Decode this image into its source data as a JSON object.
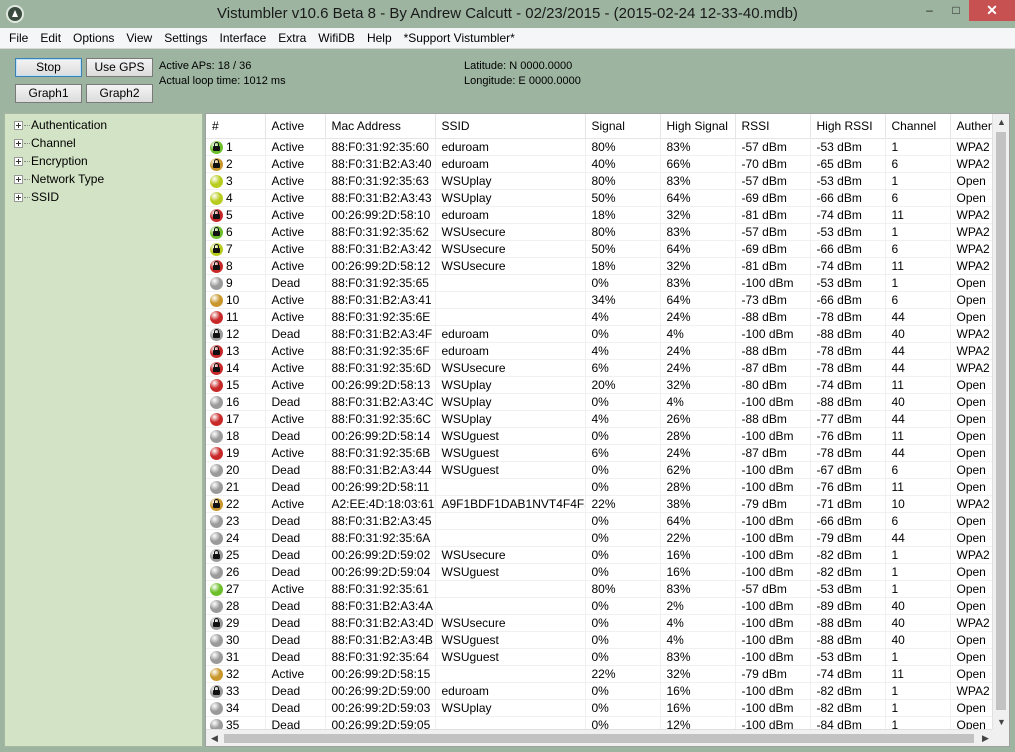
{
  "window": {
    "title": "Vistumbler v10.6 Beta 8 - By Andrew Calcutt - 02/23/2015 - (2015-02-24 12-33-40.mdb)",
    "minimize": "–",
    "maximize": "□",
    "close": "✕"
  },
  "menu": [
    "File",
    "Edit",
    "Options",
    "View",
    "Settings",
    "Interface",
    "Extra",
    "WifiDB",
    "Help",
    "*Support Vistumbler*"
  ],
  "controls": {
    "stop": "Stop",
    "use_gps": "Use GPS",
    "graph1": "Graph1",
    "graph2": "Graph2",
    "active_aps": "Active APs: 18 / 36",
    "loop_time": "Actual loop time: 1012 ms",
    "latitude": "Latitude: N 0000.0000",
    "longitude": "Longitude: E 0000.0000"
  },
  "tree": [
    "Authentication",
    "Channel",
    "Encryption",
    "Network Type",
    "SSID"
  ],
  "columns": [
    "#",
    "Active",
    "Mac Address",
    "SSID",
    "Signal",
    "High Signal",
    "RSSI",
    "High RSSI",
    "Channel",
    "Authen"
  ],
  "status_colors": {
    "green": "#6cbf2a",
    "yellowgreen": "#b8cc1e",
    "orange": "#c8962a",
    "red": "#c82828",
    "gray": "#9a9a9a"
  },
  "rows": [
    {
      "num": "1",
      "active": "Active",
      "mac": "88:F0:31:92:35:60",
      "ssid": "eduroam",
      "signal": "80%",
      "high_signal": "83%",
      "rssi": "-57 dBm",
      "high_rssi": "-53 dBm",
      "channel": "1",
      "auth": "WPA2",
      "color": "green",
      "lock": true
    },
    {
      "num": "2",
      "active": "Active",
      "mac": "88:F0:31:B2:A3:40",
      "ssid": "eduroam",
      "signal": "40%",
      "high_signal": "66%",
      "rssi": "-70 dBm",
      "high_rssi": "-65 dBm",
      "channel": "6",
      "auth": "WPA2",
      "color": "orange",
      "lock": true
    },
    {
      "num": "3",
      "active": "Active",
      "mac": "88:F0:31:92:35:63",
      "ssid": "WSUplay",
      "signal": "80%",
      "high_signal": "83%",
      "rssi": "-57 dBm",
      "high_rssi": "-53 dBm",
      "channel": "1",
      "auth": "Open",
      "color": "yellowgreen",
      "lock": false
    },
    {
      "num": "4",
      "active": "Active",
      "mac": "88:F0:31:B2:A3:43",
      "ssid": "WSUplay",
      "signal": "50%",
      "high_signal": "64%",
      "rssi": "-69 dBm",
      "high_rssi": "-66 dBm",
      "channel": "6",
      "auth": "Open",
      "color": "yellowgreen",
      "lock": false
    },
    {
      "num": "5",
      "active": "Active",
      "mac": "00:26:99:2D:58:10",
      "ssid": "eduroam",
      "signal": "18%",
      "high_signal": "32%",
      "rssi": "-81 dBm",
      "high_rssi": "-74 dBm",
      "channel": "11",
      "auth": "WPA2",
      "color": "red",
      "lock": true
    },
    {
      "num": "6",
      "active": "Active",
      "mac": "88:F0:31:92:35:62",
      "ssid": "WSUsecure",
      "signal": "80%",
      "high_signal": "83%",
      "rssi": "-57 dBm",
      "high_rssi": "-53 dBm",
      "channel": "1",
      "auth": "WPA2",
      "color": "green",
      "lock": true
    },
    {
      "num": "7",
      "active": "Active",
      "mac": "88:F0:31:B2:A3:42",
      "ssid": "WSUsecure",
      "signal": "50%",
      "high_signal": "64%",
      "rssi": "-69 dBm",
      "high_rssi": "-66 dBm",
      "channel": "6",
      "auth": "WPA2",
      "color": "yellowgreen",
      "lock": true
    },
    {
      "num": "8",
      "active": "Active",
      "mac": "00:26:99:2D:58:12",
      "ssid": "WSUsecure",
      "signal": "18%",
      "high_signal": "32%",
      "rssi": "-81 dBm",
      "high_rssi": "-74 dBm",
      "channel": "11",
      "auth": "WPA2",
      "color": "red",
      "lock": true
    },
    {
      "num": "9",
      "active": "Dead",
      "mac": "88:F0:31:92:35:65",
      "ssid": "",
      "signal": "0%",
      "high_signal": "83%",
      "rssi": "-100 dBm",
      "high_rssi": "-53 dBm",
      "channel": "1",
      "auth": "Open",
      "color": "gray",
      "lock": false
    },
    {
      "num": "10",
      "active": "Active",
      "mac": "88:F0:31:B2:A3:41",
      "ssid": "",
      "signal": "34%",
      "high_signal": "64%",
      "rssi": "-73 dBm",
      "high_rssi": "-66 dBm",
      "channel": "6",
      "auth": "Open",
      "color": "orange",
      "lock": false
    },
    {
      "num": "11",
      "active": "Active",
      "mac": "88:F0:31:92:35:6E",
      "ssid": "",
      "signal": "4%",
      "high_signal": "24%",
      "rssi": "-88 dBm",
      "high_rssi": "-78 dBm",
      "channel": "44",
      "auth": "Open",
      "color": "red",
      "lock": false
    },
    {
      "num": "12",
      "active": "Dead",
      "mac": "88:F0:31:B2:A3:4F",
      "ssid": "eduroam",
      "signal": "0%",
      "high_signal": "4%",
      "rssi": "-100 dBm",
      "high_rssi": "-88 dBm",
      "channel": "40",
      "auth": "WPA2",
      "color": "gray",
      "lock": true
    },
    {
      "num": "13",
      "active": "Active",
      "mac": "88:F0:31:92:35:6F",
      "ssid": "eduroam",
      "signal": "4%",
      "high_signal": "24%",
      "rssi": "-88 dBm",
      "high_rssi": "-78 dBm",
      "channel": "44",
      "auth": "WPA2",
      "color": "red",
      "lock": true
    },
    {
      "num": "14",
      "active": "Active",
      "mac": "88:F0:31:92:35:6D",
      "ssid": "WSUsecure",
      "signal": "6%",
      "high_signal": "24%",
      "rssi": "-87 dBm",
      "high_rssi": "-78 dBm",
      "channel": "44",
      "auth": "WPA2",
      "color": "red",
      "lock": true
    },
    {
      "num": "15",
      "active": "Active",
      "mac": "00:26:99:2D:58:13",
      "ssid": "WSUplay",
      "signal": "20%",
      "high_signal": "32%",
      "rssi": "-80 dBm",
      "high_rssi": "-74 dBm",
      "channel": "11",
      "auth": "Open",
      "color": "red",
      "lock": false
    },
    {
      "num": "16",
      "active": "Dead",
      "mac": "88:F0:31:B2:A3:4C",
      "ssid": "WSUplay",
      "signal": "0%",
      "high_signal": "4%",
      "rssi": "-100 dBm",
      "high_rssi": "-88 dBm",
      "channel": "40",
      "auth": "Open",
      "color": "gray",
      "lock": false
    },
    {
      "num": "17",
      "active": "Active",
      "mac": "88:F0:31:92:35:6C",
      "ssid": "WSUplay",
      "signal": "4%",
      "high_signal": "26%",
      "rssi": "-88 dBm",
      "high_rssi": "-77 dBm",
      "channel": "44",
      "auth": "Open",
      "color": "red",
      "lock": false
    },
    {
      "num": "18",
      "active": "Dead",
      "mac": "00:26:99:2D:58:14",
      "ssid": "WSUguest",
      "signal": "0%",
      "high_signal": "28%",
      "rssi": "-100 dBm",
      "high_rssi": "-76 dBm",
      "channel": "11",
      "auth": "Open",
      "color": "gray",
      "lock": false
    },
    {
      "num": "19",
      "active": "Active",
      "mac": "88:F0:31:92:35:6B",
      "ssid": "WSUguest",
      "signal": "6%",
      "high_signal": "24%",
      "rssi": "-87 dBm",
      "high_rssi": "-78 dBm",
      "channel": "44",
      "auth": "Open",
      "color": "red",
      "lock": false
    },
    {
      "num": "20",
      "active": "Dead",
      "mac": "88:F0:31:B2:A3:44",
      "ssid": "WSUguest",
      "signal": "0%",
      "high_signal": "62%",
      "rssi": "-100 dBm",
      "high_rssi": "-67 dBm",
      "channel": "6",
      "auth": "Open",
      "color": "gray",
      "lock": false
    },
    {
      "num": "21",
      "active": "Dead",
      "mac": "00:26:99:2D:58:11",
      "ssid": "",
      "signal": "0%",
      "high_signal": "28%",
      "rssi": "-100 dBm",
      "high_rssi": "-76 dBm",
      "channel": "11",
      "auth": "Open",
      "color": "gray",
      "lock": false
    },
    {
      "num": "22",
      "active": "Active",
      "mac": "A2:EE:4D:18:03:61",
      "ssid": "A9F1BDF1DAB1NVT4F4F59",
      "signal": "22%",
      "high_signal": "38%",
      "rssi": "-79 dBm",
      "high_rssi": "-71 dBm",
      "channel": "10",
      "auth": "WPA2",
      "color": "orange",
      "lock": true
    },
    {
      "num": "23",
      "active": "Dead",
      "mac": "88:F0:31:B2:A3:45",
      "ssid": "",
      "signal": "0%",
      "high_signal": "64%",
      "rssi": "-100 dBm",
      "high_rssi": "-66 dBm",
      "channel": "6",
      "auth": "Open",
      "color": "gray",
      "lock": false
    },
    {
      "num": "24",
      "active": "Dead",
      "mac": "88:F0:31:92:35:6A",
      "ssid": "",
      "signal": "0%",
      "high_signal": "22%",
      "rssi": "-100 dBm",
      "high_rssi": "-79 dBm",
      "channel": "44",
      "auth": "Open",
      "color": "gray",
      "lock": false
    },
    {
      "num": "25",
      "active": "Dead",
      "mac": "00:26:99:2D:59:02",
      "ssid": "WSUsecure",
      "signal": "0%",
      "high_signal": "16%",
      "rssi": "-100 dBm",
      "high_rssi": "-82 dBm",
      "channel": "1",
      "auth": "WPA2",
      "color": "gray",
      "lock": true
    },
    {
      "num": "26",
      "active": "Dead",
      "mac": "00:26:99:2D:59:04",
      "ssid": "WSUguest",
      "signal": "0%",
      "high_signal": "16%",
      "rssi": "-100 dBm",
      "high_rssi": "-82 dBm",
      "channel": "1",
      "auth": "Open",
      "color": "gray",
      "lock": false
    },
    {
      "num": "27",
      "active": "Active",
      "mac": "88:F0:31:92:35:61",
      "ssid": "",
      "signal": "80%",
      "high_signal": "83%",
      "rssi": "-57 dBm",
      "high_rssi": "-53 dBm",
      "channel": "1",
      "auth": "Open",
      "color": "green",
      "lock": false
    },
    {
      "num": "28",
      "active": "Dead",
      "mac": "88:F0:31:B2:A3:4A",
      "ssid": "",
      "signal": "0%",
      "high_signal": "2%",
      "rssi": "-100 dBm",
      "high_rssi": "-89 dBm",
      "channel": "40",
      "auth": "Open",
      "color": "gray",
      "lock": false
    },
    {
      "num": "29",
      "active": "Dead",
      "mac": "88:F0:31:B2:A3:4D",
      "ssid": "WSUsecure",
      "signal": "0%",
      "high_signal": "4%",
      "rssi": "-100 dBm",
      "high_rssi": "-88 dBm",
      "channel": "40",
      "auth": "WPA2",
      "color": "gray",
      "lock": true
    },
    {
      "num": "30",
      "active": "Dead",
      "mac": "88:F0:31:B2:A3:4B",
      "ssid": "WSUguest",
      "signal": "0%",
      "high_signal": "4%",
      "rssi": "-100 dBm",
      "high_rssi": "-88 dBm",
      "channel": "40",
      "auth": "Open",
      "color": "gray",
      "lock": false
    },
    {
      "num": "31",
      "active": "Dead",
      "mac": "88:F0:31:92:35:64",
      "ssid": "WSUguest",
      "signal": "0%",
      "high_signal": "83%",
      "rssi": "-100 dBm",
      "high_rssi": "-53 dBm",
      "channel": "1",
      "auth": "Open",
      "color": "gray",
      "lock": false
    },
    {
      "num": "32",
      "active": "Active",
      "mac": "00:26:99:2D:58:15",
      "ssid": "",
      "signal": "22%",
      "high_signal": "32%",
      "rssi": "-79 dBm",
      "high_rssi": "-74 dBm",
      "channel": "11",
      "auth": "Open",
      "color": "orange",
      "lock": false
    },
    {
      "num": "33",
      "active": "Dead",
      "mac": "00:26:99:2D:59:00",
      "ssid": "eduroam",
      "signal": "0%",
      "high_signal": "16%",
      "rssi": "-100 dBm",
      "high_rssi": "-82 dBm",
      "channel": "1",
      "auth": "WPA2",
      "color": "gray",
      "lock": true
    },
    {
      "num": "34",
      "active": "Dead",
      "mac": "00:26:99:2D:59:03",
      "ssid": "WSUplay",
      "signal": "0%",
      "high_signal": "16%",
      "rssi": "-100 dBm",
      "high_rssi": "-82 dBm",
      "channel": "1",
      "auth": "Open",
      "color": "gray",
      "lock": false
    },
    {
      "num": "35",
      "active": "Dead",
      "mac": "00:26:99:2D:59:05",
      "ssid": "",
      "signal": "0%",
      "high_signal": "12%",
      "rssi": "-100 dBm",
      "high_rssi": "-84 dBm",
      "channel": "1",
      "auth": "Open",
      "color": "gray",
      "lock": false
    }
  ]
}
